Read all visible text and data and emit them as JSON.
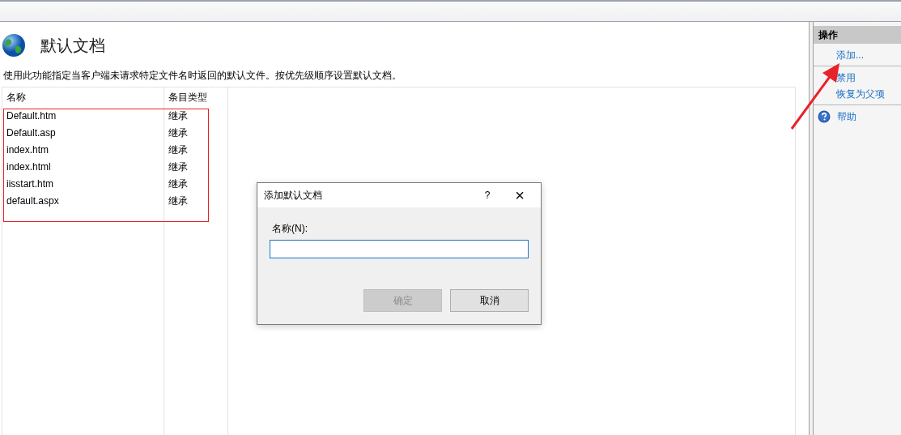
{
  "page": {
    "title": "默认文档",
    "description": "使用此功能指定当客户端未请求特定文件名时返回的默认文件。按优先级顺序设置默认文档。"
  },
  "table": {
    "columns": [
      "名称",
      "条目类型"
    ],
    "rows": [
      {
        "name": "Default.htm",
        "type": "继承"
      },
      {
        "name": "Default.asp",
        "type": "继承"
      },
      {
        "name": "index.htm",
        "type": "继承"
      },
      {
        "name": "index.html",
        "type": "继承"
      },
      {
        "name": "iisstart.htm",
        "type": "继承"
      },
      {
        "name": "default.aspx",
        "type": "继承"
      }
    ]
  },
  "actions": {
    "title": "操作",
    "groups": [
      [
        {
          "label": "添加...",
          "kind": "link"
        }
      ],
      [
        {
          "label": "禁用",
          "kind": "link"
        },
        {
          "label": "恢复为父项",
          "kind": "link"
        }
      ],
      [
        {
          "label": "帮助",
          "kind": "help"
        }
      ]
    ]
  },
  "dialog": {
    "title": "添加默认文档",
    "help": "?",
    "close": "×",
    "field_label": "名称(N):",
    "buttons": [
      {
        "label": "确定",
        "disabled": true
      },
      {
        "label": "取消",
        "disabled": false
      }
    ]
  }
}
